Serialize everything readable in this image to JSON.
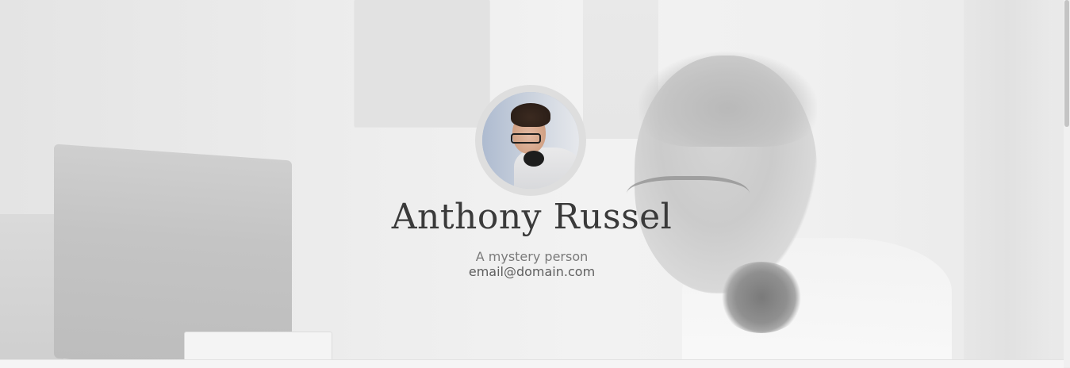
{
  "profile": {
    "name": "Anthony Russel",
    "description": "A mystery person",
    "email": "email@domain.com",
    "avatar_alt": "profile photo"
  },
  "colors": {
    "name_text": "#3a3a3a",
    "subtitle_text": "#7a7a7a",
    "avatar_ring": "#dedede",
    "background": "#ededed"
  }
}
